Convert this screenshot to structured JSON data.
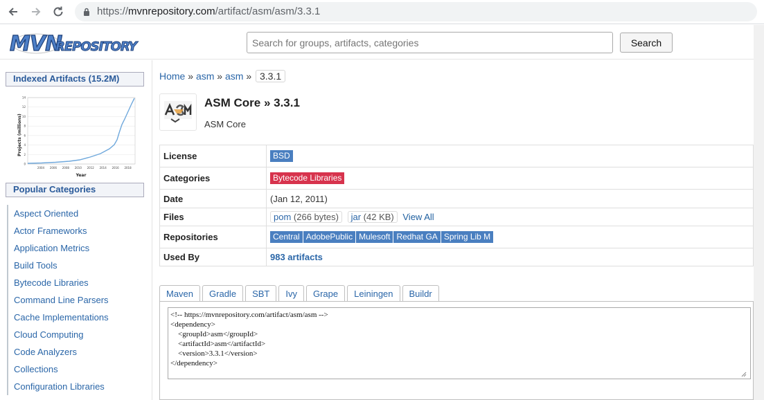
{
  "browser": {
    "url_scheme": "https://",
    "url_host": "mvnrepository.com",
    "url_path": "/artifact/asm/asm/3.3.1"
  },
  "header": {
    "logo_text": "MVNREPOSITORY",
    "search_placeholder": "Search for groups, artifacts, categories",
    "search_button": "Search"
  },
  "sidebar": {
    "indexed_title": "Indexed Artifacts (15.2M)",
    "chart": {
      "ylabel": "Projects (millions)",
      "xlabel": "Year",
      "y_ticks": [
        "0",
        "2",
        "4",
        "6",
        "8",
        "10",
        "12",
        "14"
      ],
      "x_ticks": [
        "2004",
        "2006",
        "2008",
        "2010",
        "2012",
        "2014",
        "2016",
        "2018"
      ]
    },
    "popular_title": "Popular Categories",
    "categories": [
      "Aspect Oriented",
      "Actor Frameworks",
      "Application Metrics",
      "Build Tools",
      "Bytecode Libraries",
      "Command Line Parsers",
      "Cache Implementations",
      "Cloud Computing",
      "Code Analyzers",
      "Collections",
      "Configuration Libraries"
    ]
  },
  "breadcrumb": {
    "home": "Home",
    "sep": "»",
    "group": "asm",
    "artifact": "asm",
    "version": "3.3.1"
  },
  "artifact": {
    "title": "ASM Core » 3.3.1",
    "subtitle": "ASM Core"
  },
  "info": {
    "license_label": "License",
    "license": "BSD",
    "categories_label": "Categories",
    "category": "Bytecode Libraries",
    "date_label": "Date",
    "date": "(Jan 12, 2011)",
    "files_label": "Files",
    "file_pom": "pom",
    "file_pom_size": "(266 bytes)",
    "file_jar": "jar",
    "file_jar_size": "(42 KB)",
    "view_all": "View All",
    "repos_label": "Repositories",
    "repositories": [
      "Central",
      "AdobePublic",
      "Mulesoft",
      "Redhat GA",
      "Spring Lib M"
    ],
    "used_by_label": "Used By",
    "used_by": "983 artifacts"
  },
  "tabs": [
    "Maven",
    "Gradle",
    "SBT",
    "Ivy",
    "Grape",
    "Leiningen",
    "Buildr"
  ],
  "snippet": "<!-- https://mvnrepository.com/artifact/asm/asm -->\n<dependency>\n    <groupId>asm</groupId>\n    <artifactId>asm</artifactId>\n    <version>3.3.1</version>\n</dependency>",
  "colors": {
    "accent_blue": "#4a7fc0",
    "category_red": "#d7334d",
    "link": "#2a66a8"
  }
}
